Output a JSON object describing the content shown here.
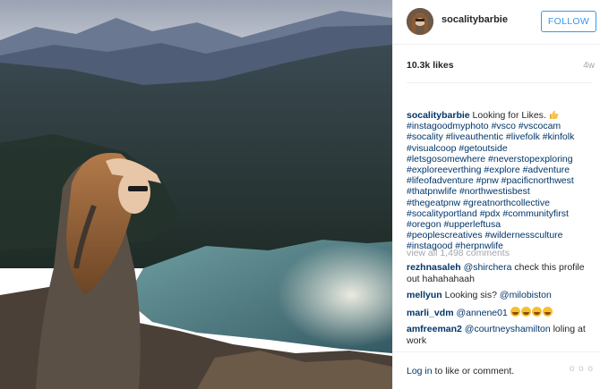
{
  "post": {
    "username": "socalitybarbie",
    "follow_label": "FOLLOW",
    "likes": "10.3k likes",
    "time_ago": "4w",
    "caption": {
      "username": "socalitybarbie",
      "text": "Looking for Likes.",
      "emoji": "thumbs-up",
      "hashtags": [
        "#instagoodmyphoto #vsco #vscocam",
        "#socality #liveauthentic #livefolk #kinfolk",
        "#visualcoop #getoutside",
        "#letsgosomewhere #neverstopexploring",
        "#exploreeverthing #explore #adventure",
        "#lifeofadventure #pnw #pacificnorthwest",
        "#thatpnwlife #northwestisbest",
        "#thegeatpnw #greatnorthcollective",
        "#socalityportland #pdx #communityfirst",
        "#oregon #upperleftusa",
        "#peoplescreatives #wildernessculture",
        "#instagood #herpnwlife"
      ]
    },
    "view_all_comments": "view all 1,498 comments",
    "comments": [
      {
        "user": "rezhnasaleh",
        "mention": "@shirchera",
        "text": " check this profile out hahahahaah"
      },
      {
        "user": "mellyun",
        "text": " Looking sis? ",
        "mention": "@milobiston"
      },
      {
        "user": "marli_vdm",
        "mention": "@annene01",
        "emoji_count": 4
      },
      {
        "user": "amfreeman2",
        "mention": "@courtneyshamilton",
        "text": " loling at work"
      }
    ],
    "footer": {
      "login_link": "Log in",
      "login_text": " to like or comment.",
      "more_label": "o o o"
    }
  },
  "colors": {
    "link": "#003569",
    "follow_blue": "#3897f0",
    "muted": "#a5a7aa",
    "text": "#262626"
  },
  "icons": {
    "more": "ellipsis-icon",
    "thumbs": "thumbs-up-icon",
    "emoji": "laughing-face-icon"
  }
}
